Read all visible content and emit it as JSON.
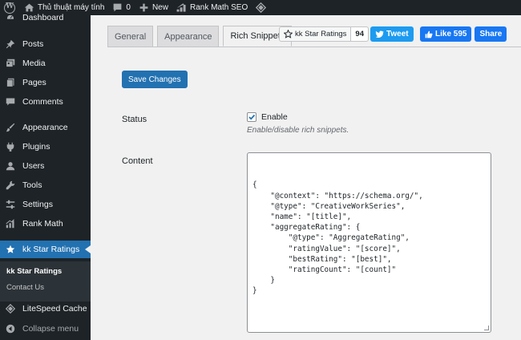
{
  "admin_bar": {
    "site_name": "Thủ thuật máy tính",
    "comments_count": "0",
    "new_label": "New",
    "seo_label": "Rank Math SEO"
  },
  "sidebar": {
    "dashboard": "Dashboard",
    "posts": "Posts",
    "media": "Media",
    "pages": "Pages",
    "comments": "Comments",
    "appearance": "Appearance",
    "plugins": "Plugins",
    "users": "Users",
    "tools": "Tools",
    "settings": "Settings",
    "rank_math": "Rank Math",
    "kk_star_ratings": "kk Star Ratings",
    "submenu": {
      "kk_star_ratings": "kk Star Ratings",
      "contact_us": "Contact Us"
    },
    "litespeed": "LiteSpeed Cache",
    "collapse": "Collapse menu"
  },
  "tabs": [
    "General",
    "Appearance",
    "Rich Snippets"
  ],
  "active_tab": "Rich Snippets",
  "social": {
    "github_label": "kk Star Ratings",
    "github_count": "94",
    "tweet_label": "Tweet",
    "like_label": "Like 595",
    "share_label": "Share"
  },
  "save_button": "Save Changes",
  "status": {
    "label": "Status",
    "checkbox_label": "Enable",
    "checked": true,
    "description": "Enable/disable rich snippets."
  },
  "content": {
    "label": "Content",
    "code": "{\n    \"@context\": \"https://schema.org/\",\n    \"@type\": \"CreativeWorkSeries\",\n    \"name\": \"[title]\",\n    \"aggregateRating\": {\n        \"@type\": \"AggregateRating\",\n        \"ratingValue\": \"[score]\",\n        \"bestRating\": \"[best]\",\n        \"ratingCount\": \"[count]\"\n    }\n}"
  },
  "colors": {
    "admin_dark": "#1d2327",
    "accent": "#2271b1",
    "twitter": "#1d9bf0",
    "facebook": "#1877f2"
  }
}
